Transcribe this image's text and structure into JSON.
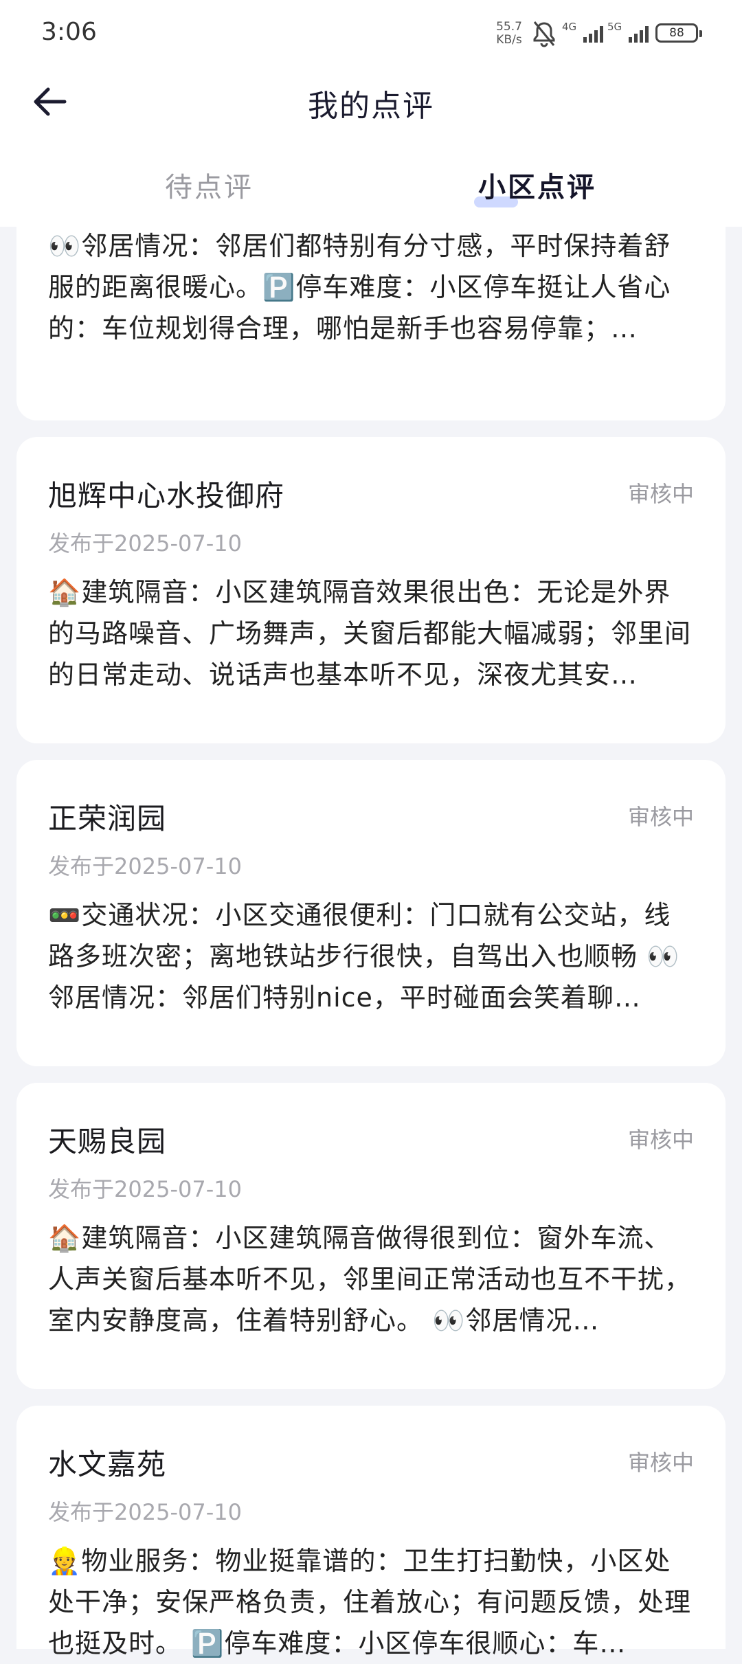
{
  "status_bar": {
    "time": "3:06",
    "net_speed": "55.7",
    "net_unit": "KB/s",
    "signal1": "4G",
    "signal2": "5G",
    "battery": "88"
  },
  "header": {
    "title": "我的点评",
    "back_icon": "back-arrow-icon"
  },
  "tabs": [
    {
      "label": "待点评",
      "active": false
    },
    {
      "label": "小区点评",
      "active": true
    }
  ],
  "partial_review": {
    "body": "👀邻居情况：邻居们都特别有分寸感，平时保持着舒服的距离很暖心。🅿️停车难度：小区停车挺让人省心的：车位规划得合理，哪怕是新手也容易停靠；…"
  },
  "reviews": [
    {
      "name": "旭辉中心水投御府",
      "status": "审核中",
      "date": "发布于2025-07-10",
      "body": "🏠建筑隔音：小区建筑隔音效果很出色：无论是外界的马路噪音、广场舞声，关窗后都能大幅减弱；邻里间的日常走动、说话声也基本听不见，深夜尤其安…"
    },
    {
      "name": "正荣润园",
      "status": "审核中",
      "date": "发布于2025-07-10",
      "body": "🚥交通状况：小区交通很便利：门口就有公交站，线路多班次密；离地铁站步行很快，自驾出入也顺畅 👀邻居情况：邻居们特别nice，平时碰面会笑着聊…"
    },
    {
      "name": "天赐良园",
      "status": "审核中",
      "date": "发布于2025-07-10",
      "body": "🏠建筑隔音：小区建筑隔音做得很到位：窗外车流、人声关窗后基本听不见，邻里间正常活动也互不干扰，室内安静度高，住着特别舒心。 👀邻居情况…"
    },
    {
      "name": "水文嘉苑",
      "status": "审核中",
      "date": "发布于2025-07-10",
      "body": "👷物业服务：物业挺靠谱的：卫生打扫勤快，小区处处干净；安保严格负责，住着放心；有问题反馈，处理也挺及时。 🅿️停车难度：小区停车很顺心：车…"
    }
  ]
}
